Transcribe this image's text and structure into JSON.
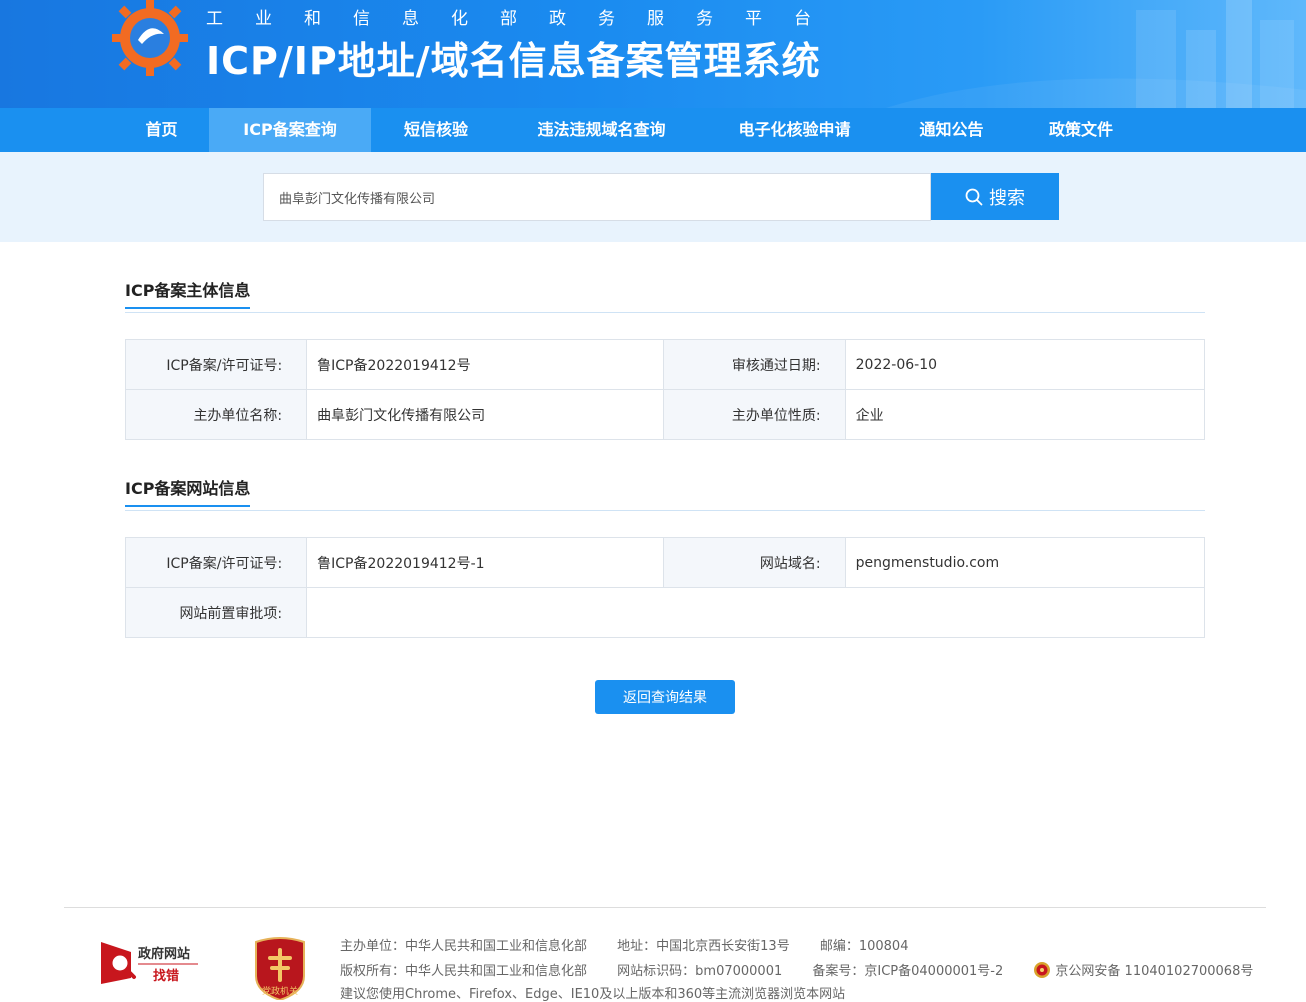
{
  "header": {
    "tagline": "工业和信息化部政务服务平台",
    "title": "ICP/IP地址/域名信息备案管理系统"
  },
  "nav": {
    "items": [
      {
        "label": "首页"
      },
      {
        "label": "ICP备案查询",
        "active": true
      },
      {
        "label": "短信核验"
      },
      {
        "label": "违法违规域名查询"
      },
      {
        "label": "电子化核验申请"
      },
      {
        "label": "通知公告"
      },
      {
        "label": "政策文件"
      }
    ]
  },
  "search": {
    "value": "曲阜彭门文化传播有限公司",
    "button_label": "搜索",
    "icon": "search-icon"
  },
  "subject_section": {
    "title": "ICP备案主体信息",
    "rows": [
      {
        "label1": "ICP备案/许可证号:",
        "value1": "鲁ICP备2022019412号",
        "label2": "审核通过日期:",
        "value2": "2022-06-10"
      },
      {
        "label1": "主办单位名称:",
        "value1": "曲阜彭门文化传播有限公司",
        "label2": "主办单位性质:",
        "value2": "企业"
      }
    ]
  },
  "website_section": {
    "title": "ICP备案网站信息",
    "rows": [
      {
        "label1": "ICP备案/许可证号:",
        "value1": "鲁ICP备2022019412号-1",
        "label2": "网站域名:",
        "value2": "pengmenstudio.com"
      },
      {
        "label1": "网站前置审批项:",
        "value1": ""
      }
    ]
  },
  "return_button": "返回查询结果",
  "footer": {
    "gov_badge": {
      "line1": "政府网站",
      "line2": "找错"
    },
    "party_badge_text": "党政机关",
    "line1": {
      "host": "主办单位：中华人民共和国工业和信息化部",
      "address": "地址：中国北京西长安街13号",
      "postcode": "邮编：100804"
    },
    "line2": {
      "copyright": "版权所有：中华人民共和国工业和信息化部",
      "site_id": "网站标识码：bm07000001",
      "icp": "备案号：京ICP备04000001号-2",
      "police": "京公网安备 11040102700068号"
    },
    "line3": "建议您使用Chrome、Firefox、Edge、IE10及以上版本和360等主流浏览器浏览本网站"
  },
  "colors": {
    "brand_blue": "#1a90f0",
    "nav_active": "#4aaaf6",
    "search_band": "#e8f3fd",
    "label_bg": "#f4f7fb"
  }
}
